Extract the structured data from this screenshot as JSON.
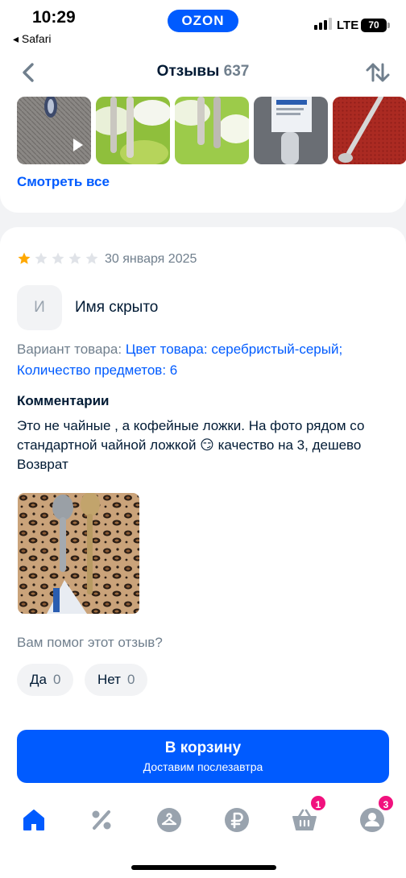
{
  "status_bar": {
    "time": "10:29",
    "back_app": "◂ Safari",
    "brand": "OZON",
    "network": "LTE",
    "battery": "70"
  },
  "header": {
    "title": "Отзывы",
    "count": "637"
  },
  "photos": {
    "see_all_label": "Смотреть все"
  },
  "review": {
    "rating": 1,
    "rating_max": 5,
    "date": "30 января 2025",
    "avatar_letter": "И",
    "author": "Имя скрыто",
    "variant_label": "Вариант товара:",
    "variant_value": "Цвет товара: серебристый-серый; Количество предметов: 6",
    "comments_title": "Комментарии",
    "comment_text": "Это не чайные , а кофейные ложки. На фото рядом со стандартной чайной ложкой 😏 качество на 3, дешево Возврат",
    "helpful_question": "Вам помог этот отзыв?",
    "yes_label": "Да",
    "yes_count": "0",
    "no_label": "Нет",
    "no_count": "0"
  },
  "cart": {
    "title": "В корзину",
    "subtitle": "Доставим послезавтра"
  },
  "tabbar": {
    "items": [
      {
        "icon": "home-icon",
        "badge": ""
      },
      {
        "icon": "percent-icon",
        "badge": ""
      },
      {
        "icon": "hanger-icon",
        "badge": ""
      },
      {
        "icon": "ruble-icon",
        "badge": ""
      },
      {
        "icon": "basket-icon",
        "badge": "1"
      },
      {
        "icon": "profile-icon",
        "badge": "3"
      }
    ]
  },
  "colors": {
    "accent": "#005bff",
    "badge": "#f1117e",
    "star_filled": "#ffa800",
    "star_empty": "#e0e3e8"
  }
}
